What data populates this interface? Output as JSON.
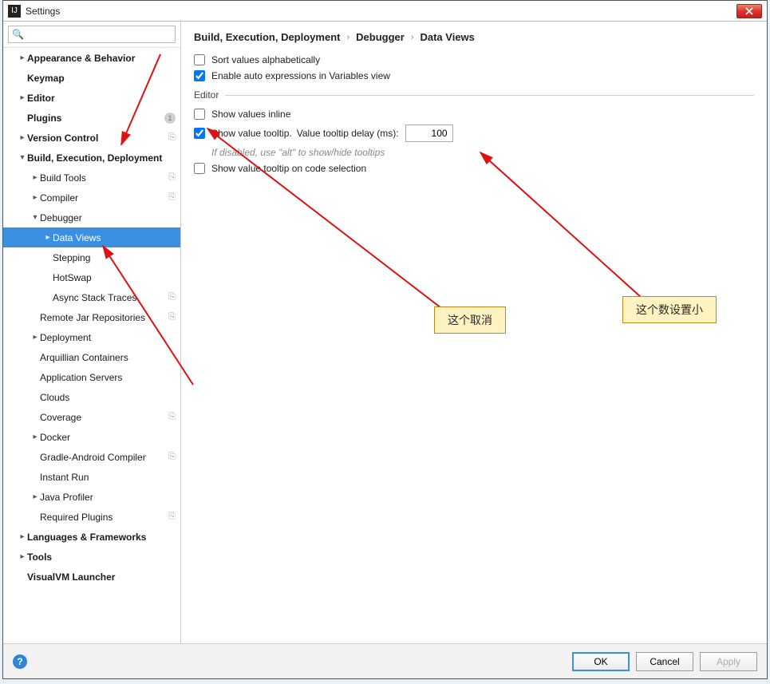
{
  "window": {
    "title": "Settings"
  },
  "search": {
    "placeholder": ""
  },
  "tree": {
    "appearance": "Appearance & Behavior",
    "keymap": "Keymap",
    "editor": "Editor",
    "plugins": "Plugins",
    "plugins_badge": "1",
    "version_control": "Version Control",
    "bed": "Build, Execution, Deployment",
    "build_tools": "Build Tools",
    "compiler": "Compiler",
    "debugger": "Debugger",
    "data_views": "Data Views",
    "stepping": "Stepping",
    "hotswap": "HotSwap",
    "async": "Async Stack Traces",
    "remote_jar": "Remote Jar Repositories",
    "deployment": "Deployment",
    "arquillian": "Arquillian Containers",
    "app_servers": "Application Servers",
    "clouds": "Clouds",
    "coverage": "Coverage",
    "docker": "Docker",
    "gradle_android": "Gradle-Android Compiler",
    "instant_run": "Instant Run",
    "java_profiler": "Java Profiler",
    "required_plugins": "Required Plugins",
    "lang_fw": "Languages & Frameworks",
    "tools": "Tools",
    "visualvm": "VisualVM Launcher"
  },
  "breadcrumb": {
    "a": "Build, Execution, Deployment",
    "b": "Debugger",
    "c": "Data Views"
  },
  "opts": {
    "sort": "Sort values alphabetically",
    "auto_expr": "Enable auto expressions in Variables view",
    "section_editor": "Editor",
    "inline": "Show values inline",
    "tooltip": "Show value tooltip.",
    "tooltip_delay_label": "Value tooltip delay (ms):",
    "tooltip_delay_value": "100",
    "tooltip_hint": "If disabled, use \"alt\" to show/hide tooltips",
    "code_sel": "Show value tooltip on code selection"
  },
  "buttons": {
    "ok": "OK",
    "cancel": "Cancel",
    "apply": "Apply"
  },
  "annotations": {
    "cancel_this": "这个取消",
    "set_small": "这个数设置小"
  }
}
